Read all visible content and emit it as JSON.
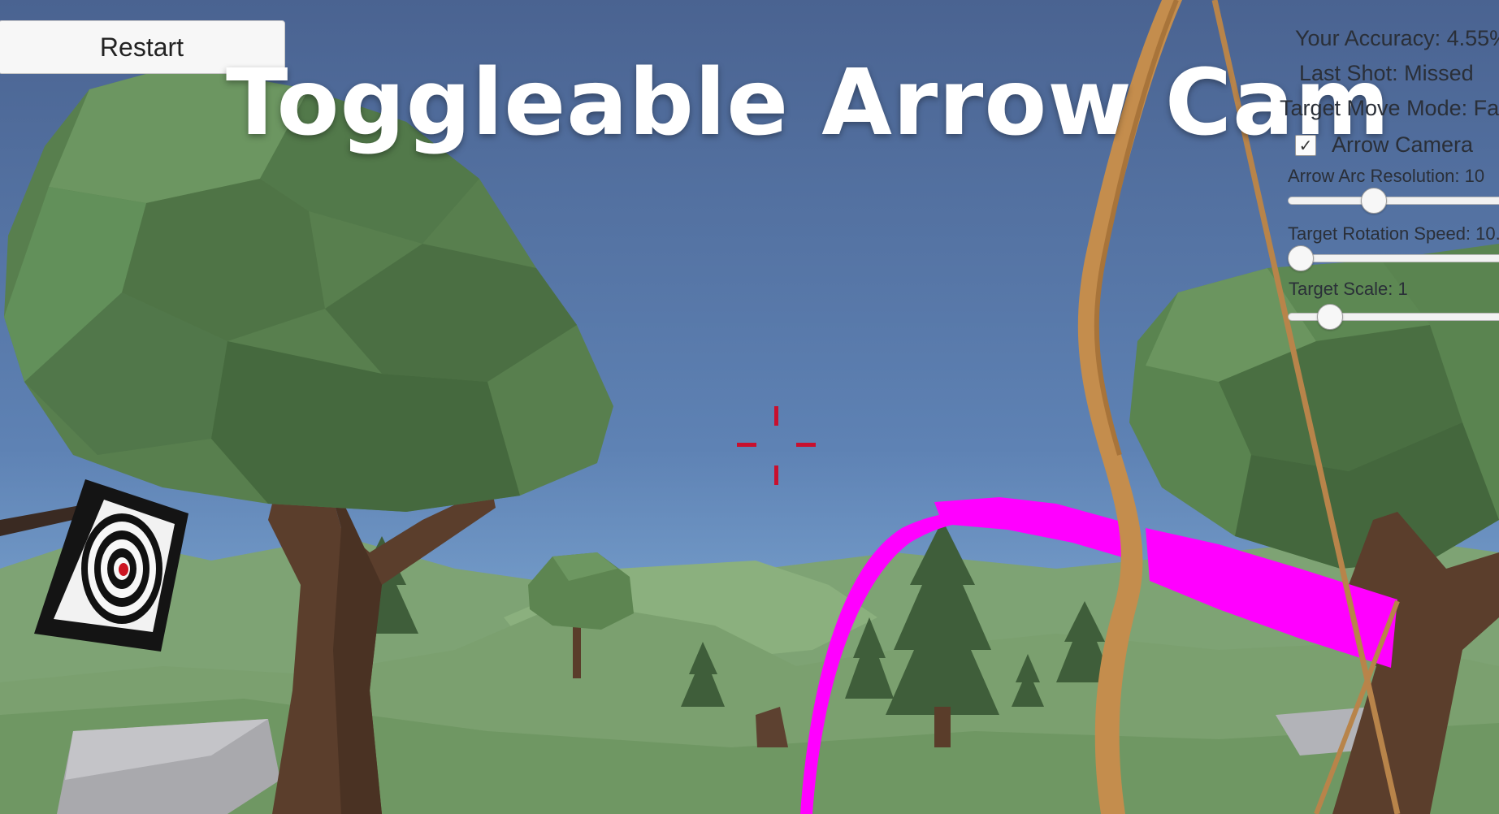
{
  "title_overlay": "Toggleable Arrow Cam",
  "restart_button": {
    "label": "Restart"
  },
  "hud": {
    "accuracy": "Your Accuracy: 4.55%",
    "last_shot": "Last Shot: Missed",
    "move_mode": "Target Move Mode: Fa",
    "arrow_camera": {
      "label": "Arrow Camera",
      "checked": true,
      "check_glyph": "✓"
    },
    "sliders": [
      {
        "label": "Arrow Arc Resolution: 10",
        "fraction": 0.3
      },
      {
        "label": "Target Rotation Speed: 10.",
        "fraction": 0.0
      },
      {
        "label": "Target Scale: 1",
        "fraction": 0.12
      }
    ]
  },
  "colors": {
    "sky_top": "#4a6391",
    "sky_bottom": "#6e98c6",
    "crosshair": "#c8102e",
    "trajectory": "#ff00ff",
    "foliage": "#5f8a55",
    "bow": "#c89250"
  },
  "icons": {
    "crosshair": "crosshair-icon",
    "checkbox_tick": "check-icon"
  }
}
